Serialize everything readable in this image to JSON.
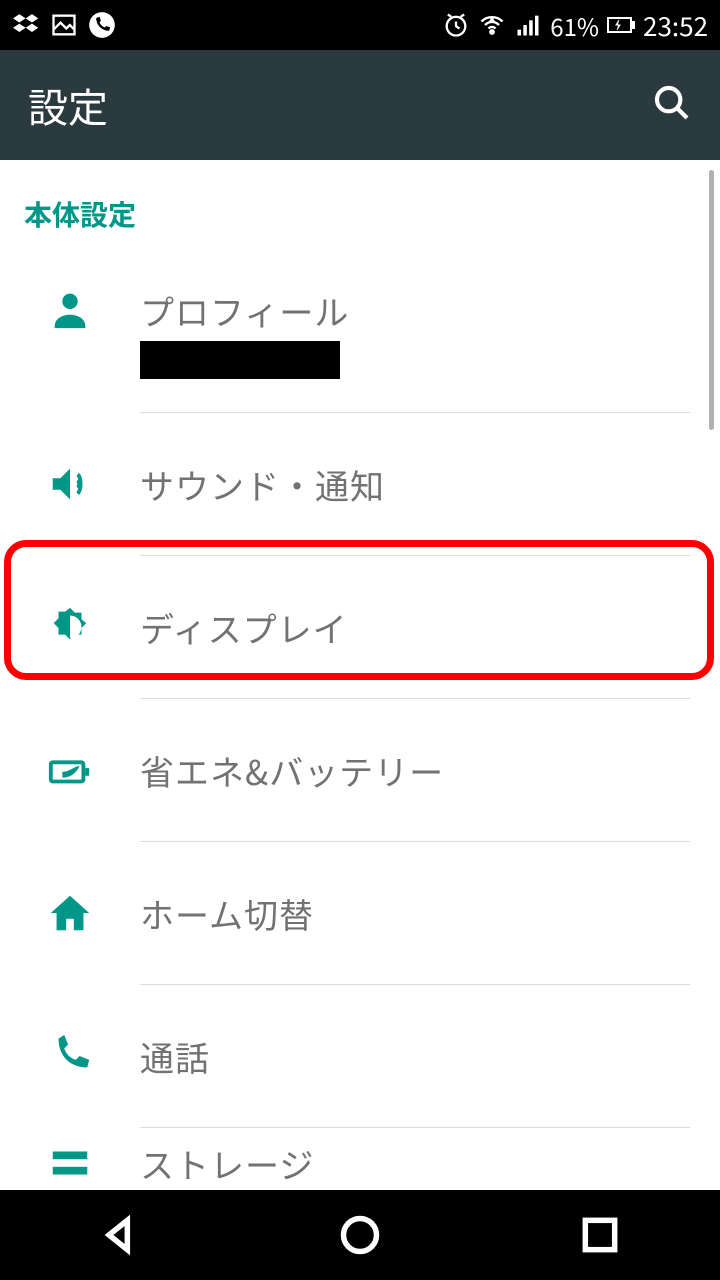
{
  "statusbar": {
    "battery_text": "61%",
    "time": "23:52"
  },
  "appbar": {
    "title": "設定"
  },
  "section": {
    "header": "本体設定"
  },
  "items": {
    "profile": {
      "title": "プロフィール"
    },
    "sound": {
      "title": "サウンド・通知"
    },
    "display": {
      "title": "ディスプレイ"
    },
    "battery": {
      "title": "省エネ&バッテリー"
    },
    "home": {
      "title": "ホーム切替"
    },
    "call": {
      "title": "通話"
    },
    "storage": {
      "title": "ストレージ"
    }
  }
}
